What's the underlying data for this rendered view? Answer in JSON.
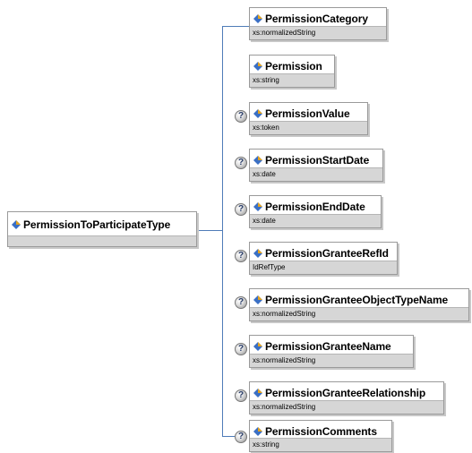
{
  "colors": {
    "connector": "#4f7cb8",
    "type_bar": "#d6d6d6",
    "icon_blue": "#3a6fc4",
    "icon_gold": "#e3a320"
  },
  "root": {
    "name": "PermissionToParticipateType"
  },
  "optional_marker": "?",
  "elements": [
    {
      "name": "PermissionCategory",
      "type": "xs:normalizedString",
      "optional": false
    },
    {
      "name": "Permission",
      "type": "xs:string",
      "optional": false
    },
    {
      "name": "PermissionValue",
      "type": "xs:token",
      "optional": true
    },
    {
      "name": "PermissionStartDate",
      "type": "xs:date",
      "optional": true
    },
    {
      "name": "PermissionEndDate",
      "type": "xs:date",
      "optional": true
    },
    {
      "name": "PermissionGranteeRefId",
      "type": "IdRefType",
      "optional": true
    },
    {
      "name": "PermissionGranteeObjectTypeName",
      "type": "xs:normalizedString",
      "optional": true
    },
    {
      "name": "PermissionGranteeName",
      "type": "xs:normalizedString",
      "optional": true
    },
    {
      "name": "PermissionGranteeRelationship",
      "type": "xs:normalizedString",
      "optional": true
    },
    {
      "name": "PermissionComments",
      "type": "xs:string",
      "optional": true
    }
  ]
}
